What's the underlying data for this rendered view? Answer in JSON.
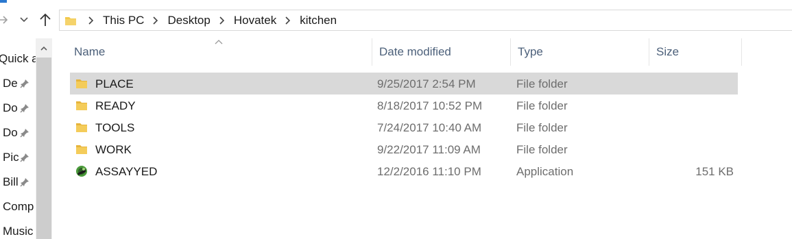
{
  "window": {
    "accent_color": "#2b79d0"
  },
  "navigation": {
    "forward_icon": "arrow-right-icon",
    "recent_icon": "chevron-down-icon",
    "up_icon": "arrow-up-icon"
  },
  "address_bar": {
    "breadcrumbs": [
      "This PC",
      "Desktop",
      "Hovatek",
      "kitchen"
    ]
  },
  "nav_pane": {
    "items": [
      {
        "label": "Quick a",
        "pinned": false
      },
      {
        "label": "De",
        "pinned": true
      },
      {
        "label": "Do",
        "pinned": true
      },
      {
        "label": "Do",
        "pinned": true
      },
      {
        "label": "Pic",
        "pinned": true
      },
      {
        "label": "Bill",
        "pinned": true
      },
      {
        "label": "Comp",
        "pinned": false
      },
      {
        "label": "Music",
        "pinned": false
      }
    ]
  },
  "columns": {
    "name": "Name",
    "date_modified": "Date modified",
    "type": "Type",
    "size": "Size"
  },
  "files": [
    {
      "name": "PLACE",
      "date": "9/25/2017 2:54 PM",
      "type": "File folder",
      "size": "",
      "icon": "folder-icon",
      "selected": true
    },
    {
      "name": "READY",
      "date": "8/18/2017 10:52 PM",
      "type": "File folder",
      "size": "",
      "icon": "folder-icon",
      "selected": false
    },
    {
      "name": "TOOLS",
      "date": "7/24/2017 10:40 AM",
      "type": "File folder",
      "size": "",
      "icon": "folder-icon",
      "selected": false
    },
    {
      "name": "WORK",
      "date": "9/22/2017 11:09 AM",
      "type": "File folder",
      "size": "",
      "icon": "folder-icon",
      "selected": false
    },
    {
      "name": "ASSAYYED",
      "date": "12/2/2016 11:10 PM",
      "type": "Application",
      "size": "151 KB",
      "icon": "application-icon",
      "selected": false
    }
  ],
  "colors": {
    "folder": "#f2c94c",
    "selection": "#d9d9d9",
    "header_text": "#4c607a"
  }
}
